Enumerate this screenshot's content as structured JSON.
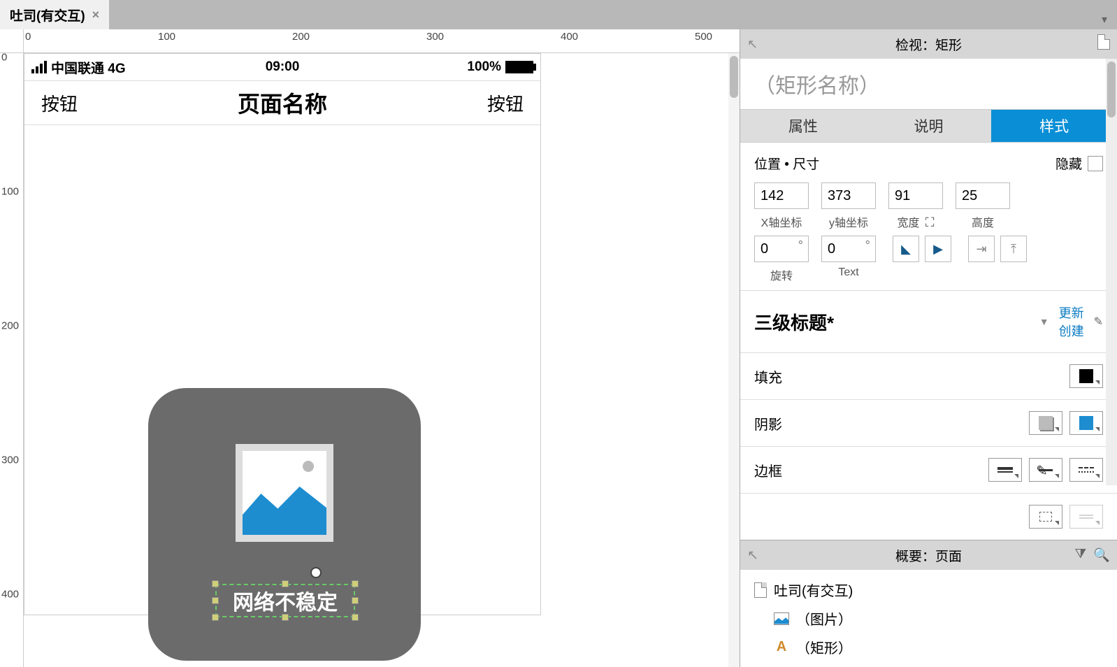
{
  "tab": {
    "title": "吐司(有交互)",
    "dropdown_icon": "▼"
  },
  "ruler": {
    "top": [
      "0",
      "100",
      "200",
      "300",
      "400",
      "500"
    ],
    "left": [
      "0",
      "100",
      "200",
      "300",
      "400"
    ]
  },
  "phone": {
    "status": {
      "carrier": "中国联通 4G",
      "time": "09:00",
      "battery": "100%"
    },
    "nav": {
      "left": "按钮",
      "title": "页面名称",
      "right": "按钮"
    },
    "toast_text": "网络不稳定"
  },
  "inspector": {
    "header": "检视：矩形",
    "name_placeholder": "（矩形名称）",
    "tabs": {
      "attr": "属性",
      "notes": "说明",
      "style": "样式"
    },
    "pos_label": "位置 • 尺寸",
    "hide_label": "隐藏",
    "x": "142",
    "y": "373",
    "w": "91",
    "h": "25",
    "xl": "X轴坐标",
    "yl": "y轴坐标",
    "wl": "宽度",
    "hl": "高度",
    "rot": "0",
    "trot": "0",
    "rotl": "旋转",
    "trotl": "Text",
    "styleName": "三级标题*",
    "update": "更新",
    "create": "创建",
    "fill": "填充",
    "shadow": "阴影",
    "border": "边框"
  },
  "outline": {
    "header": "概要：页面",
    "root": "吐司(有交互)",
    "img": "（图片）",
    "rect": "（矩形）"
  }
}
